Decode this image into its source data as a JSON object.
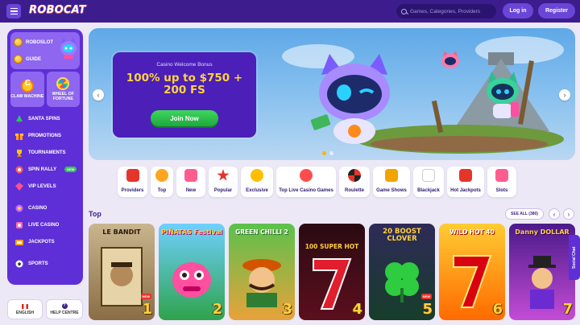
{
  "header": {
    "logo": "ROBOCAT",
    "search_placeholder": "Games, Categories, Providers",
    "login_label": "Log in",
    "register_label": "Register"
  },
  "sidebar": {
    "top": [
      "ROBOSLOT",
      "GUIDE"
    ],
    "tiles": [
      "CLAW MACHINE",
      "WHEEL OF FORTUNE"
    ],
    "items": [
      {
        "label": "SANTA SPINS",
        "icon": "tree-icon"
      },
      {
        "label": "PROMOTIONS",
        "icon": "gift-icon"
      },
      {
        "label": "TOURNAMENTS",
        "icon": "trophy-icon"
      },
      {
        "label": "SPIN RALLY",
        "icon": "rally-icon",
        "badge": "NEW"
      },
      {
        "label": "VIP LEVELS",
        "icon": "vip-icon"
      },
      {
        "label": "CASINO",
        "icon": "casino-icon"
      },
      {
        "label": "LIVE CASINO",
        "icon": "live-casino-icon"
      },
      {
        "label": "JACKPOTS",
        "icon": "jackpot-icon"
      },
      {
        "label": "SPORTS",
        "icon": "sports-icon"
      }
    ],
    "language": "ENGLISH",
    "help": "HELP CENTRE"
  },
  "banner": {
    "subtitle": "Casino Welcome Bonus",
    "title": "100% up to $750 + 200 FS",
    "cta": "Join Now"
  },
  "categories": [
    "Providers",
    "Top",
    "New",
    "Popular",
    "Exclusive",
    "Top Live Casino Games",
    "Roulette",
    "Game Shows",
    "Blackjack",
    "Hot Jackpots",
    "Slots"
  ],
  "top_section": {
    "title": "Top",
    "see_all": "SEE ALL (380)"
  },
  "games": [
    {
      "name": "LE BANDIT",
      "rank": "1",
      "new": "NEW"
    },
    {
      "name": "PIÑATAS Festival",
      "rank": "2",
      "new": ""
    },
    {
      "name": "GREEN CHILLI 2",
      "rank": "3",
      "new": ""
    },
    {
      "name": "100 SUPER HOT",
      "rank": "4",
      "new": ""
    },
    {
      "name": "20 BOOST CLOVER",
      "rank": "5",
      "new": "NEW"
    },
    {
      "name": "WILD HOT 40",
      "rank": "6",
      "new": ""
    },
    {
      "name": "Danny DOLLAR",
      "rank": "7",
      "new": ""
    }
  ],
  "social_chat": "Social Chat",
  "colors": {
    "header": "#3d1d8e",
    "sidebar": "#5e2fd6",
    "accent_gold": "#ffd23f",
    "cta_green": "#2cc14e"
  }
}
